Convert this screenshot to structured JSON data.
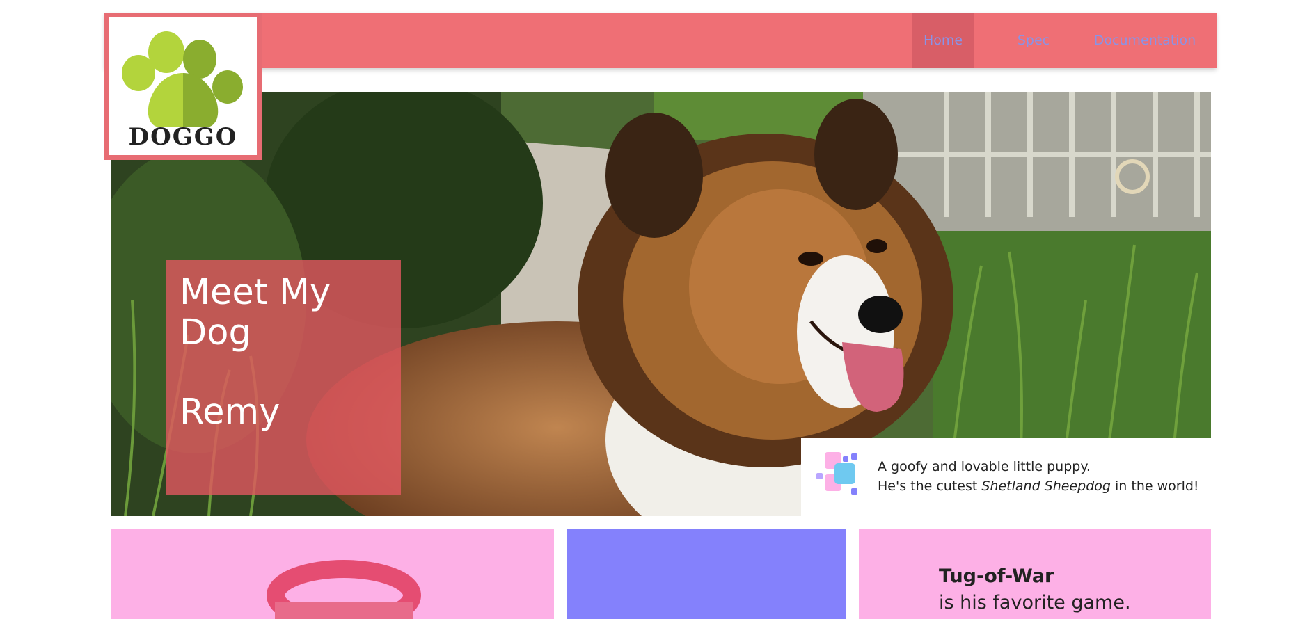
{
  "nav": {
    "links": [
      {
        "label": "Home"
      },
      {
        "label": "Spec"
      },
      {
        "label": "Documentation"
      }
    ]
  },
  "logo": {
    "text": "DOGGO"
  },
  "hero": {
    "title_line1": "Meet My",
    "title_line2": "Dog",
    "dog_name": "Remy",
    "caption_line1": "A goofy and lovable little puppy.",
    "caption_line2_pre": "He's the cutest ",
    "caption_line2_em": "Shetland Sheepdog",
    "caption_line2_post": " in the world!"
  },
  "cards": {
    "card3_title": "Tug-of-War",
    "card3_sub": "is his favorite game."
  },
  "colors": {
    "nav_bg": "#ef6f75",
    "nav_active_bg": "#d85e67",
    "nav_link": "#8a93e6",
    "card_pink": "#fdb0e6",
    "card_purple": "#8481fc"
  }
}
